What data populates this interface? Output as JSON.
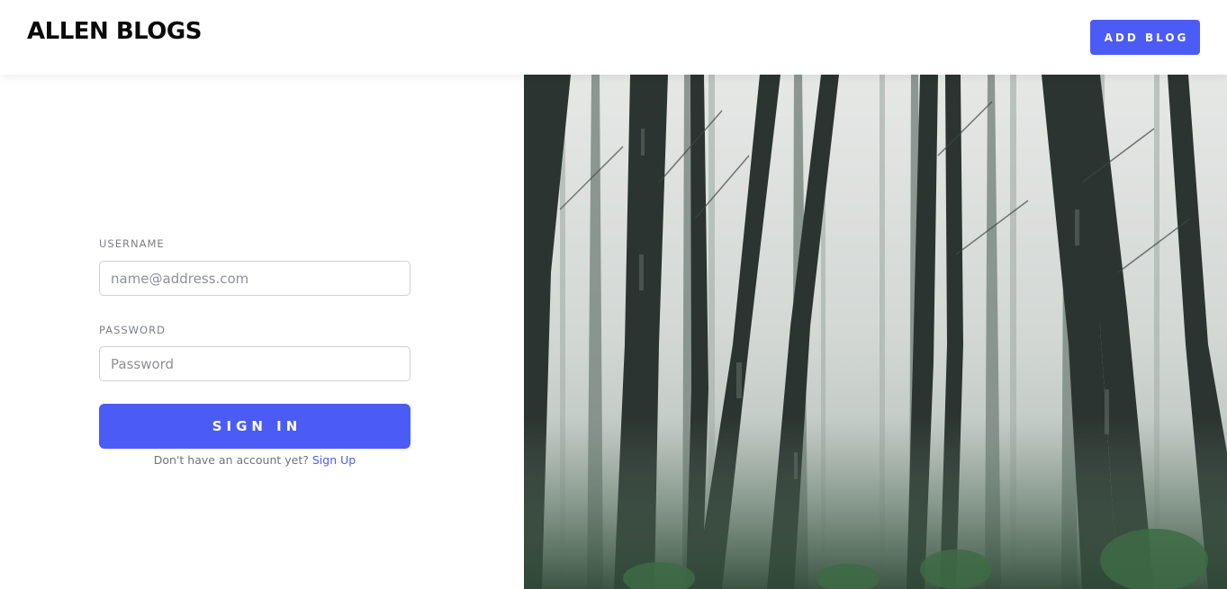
{
  "navbar": {
    "brand": "ALLEN BLOGS",
    "add_blog_label": "ADD BLOG"
  },
  "login": {
    "username_label": "USERNAME",
    "username_placeholder": "name@address.com",
    "username_value": "",
    "password_label": "PASSWORD",
    "password_placeholder": "Password",
    "password_value": "",
    "signin_label": "SIGN IN",
    "no_account_text": "Don't have an account yet?",
    "signup_link": "Sign Up"
  },
  "colors": {
    "accent": "#4a5cf5",
    "label": "#7a7f8a"
  },
  "hero_image": "misty-forest-photo"
}
